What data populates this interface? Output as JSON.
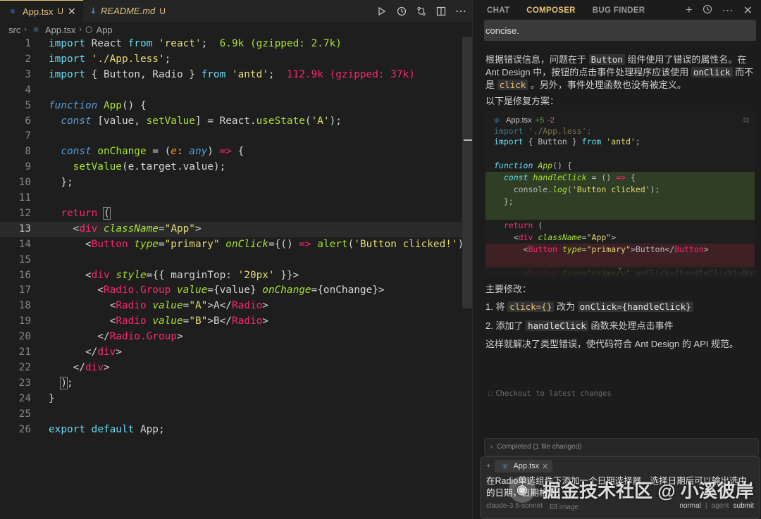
{
  "editor": {
    "tabs": [
      {
        "name": "App.tsx",
        "state": "U",
        "active": true
      },
      {
        "name": "README.md",
        "state": "U",
        "active": false
      }
    ],
    "breadcrumb": [
      "src",
      "App.tsx",
      "App"
    ],
    "current_line": 13,
    "line_numbers": [
      "1",
      "2",
      "3",
      "4",
      "5",
      "6",
      "7",
      "8",
      "9",
      "10",
      "11",
      "12",
      "13",
      "14",
      "15",
      "16",
      "17",
      "18",
      "19",
      "20",
      "21",
      "22",
      "23",
      "24",
      "25",
      "26"
    ],
    "import_sizes": {
      "react": "6.9k (gzipped: 2.7k)",
      "antd": "112.9k (gzipped: 37k)"
    }
  },
  "panel": {
    "tabs": [
      "CHAT",
      "COMPOSER",
      "BUG FINDER"
    ],
    "active_tab": "COMPOSER",
    "concise_text": "concise.",
    "explanation_1": "根据错误信息，问题在于",
    "explanation_code_button": "Button",
    "explanation_2": "组件使用了错误的属性名。在 Ant Design 中，按钮的点击事件处理程序应该使用",
    "explanation_code_onclick": "onClick",
    "explanation_3": "而不是",
    "explanation_code_click": "click",
    "explanation_4": "。另外，事件处理函数也没有被定义。",
    "fix_intro": "以下是修复方案：",
    "diff": {
      "file": "App.tsx",
      "added": "+5",
      "removed": "-2"
    },
    "main_changes_title": "主要修改：",
    "change_1_prefix": "1. 将",
    "change_1_from": "click={}",
    "change_1_mid": "改为",
    "change_1_to": "onClick={handleClick}",
    "change_2_prefix": "2. 添加了",
    "change_2_code": "handleClick",
    "change_2_suffix": "函数来处理点击事件",
    "summary": "这样就解决了类型错误，使代码符合 Ant Design 的 API 规范。",
    "checkout": "Checkout to latest changes",
    "completed": "Completed (1 file changed)",
    "input": {
      "chip": "App.tsx",
      "text": "在Radio单选组件下添加一个日期选择器，选择日期后可以输出选中的日期，日期格式",
      "model": "claude-3.5-sonnet",
      "image_label": "image",
      "mode_normal": "normal",
      "mode_agent": "agent",
      "submit": "submit"
    }
  },
  "watermark": "掘金技术社区 @ 小溪彼岸"
}
